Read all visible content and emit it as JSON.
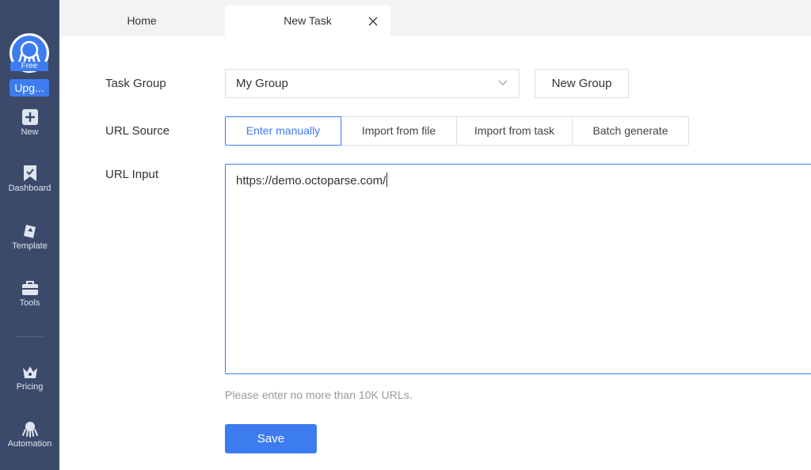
{
  "sidebar": {
    "badge": "Free",
    "upgrade_label": "Upg...",
    "items": [
      {
        "label": "New",
        "icon": "plus-square-icon"
      },
      {
        "label": "Dashboard",
        "icon": "bookmark-icon"
      },
      {
        "label": "Template",
        "icon": "template-icon"
      },
      {
        "label": "Tools",
        "icon": "toolbox-icon"
      },
      {
        "label": "Pricing",
        "icon": "crown-icon"
      },
      {
        "label": "Automation",
        "icon": "octopus-icon"
      }
    ]
  },
  "tabs": [
    {
      "label": "Home"
    },
    {
      "label": "New Task",
      "active": true
    }
  ],
  "form": {
    "task_group_label": "Task Group",
    "task_group_value": "My Group",
    "new_group_label": "New Group",
    "url_source_label": "URL Source",
    "url_source_options": [
      "Enter manually",
      "Import from file",
      "Import from task",
      "Batch generate"
    ],
    "url_source_selected": "Enter manually",
    "url_input_label": "URL Input",
    "url_input_value": "https://demo.octoparse.com/",
    "hint": "Please enter no more than 10K URLs.",
    "save_label": "Save"
  },
  "colors": {
    "sidebar_bg": "#3b4a6b",
    "accent": "#3d7bf0",
    "tabbar_bg": "#f2f3f5"
  }
}
